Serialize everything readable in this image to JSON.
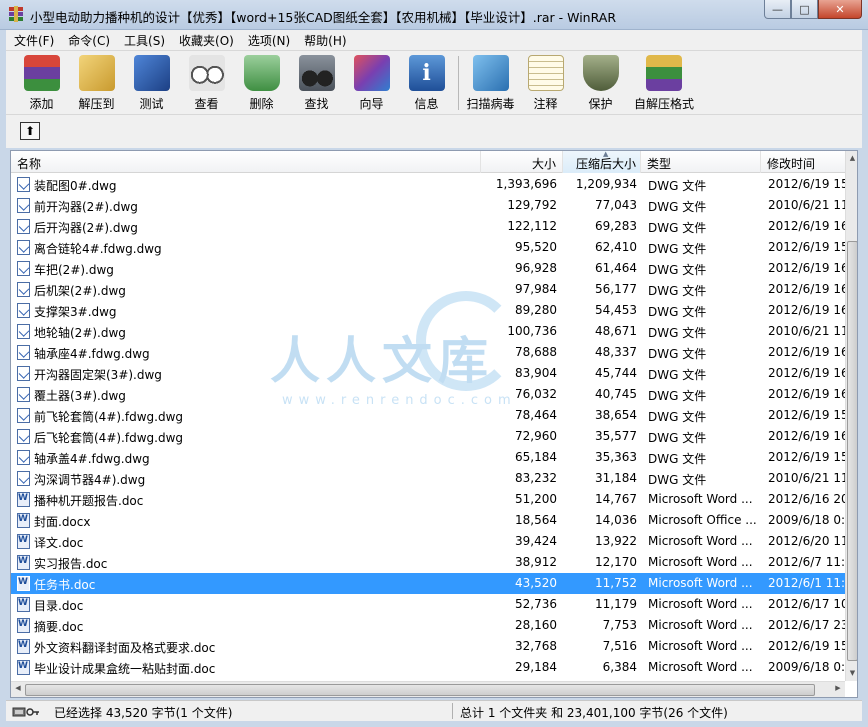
{
  "window": {
    "title": "小型电动助力播种机的设计【优秀】【word+15张CAD图纸全套】【农用机械】【毕业设计】.rar - WinRAR",
    "minimize_glyph": "—",
    "maximize_glyph": "□",
    "close_glyph": "✕"
  },
  "menu": [
    "文件(F)",
    "命令(C)",
    "工具(S)",
    "收藏夹(O)",
    "选项(N)",
    "帮助(H)"
  ],
  "toolbar": [
    {
      "label": "添加",
      "icon": "add-books-icon",
      "color": "#d8463b"
    },
    {
      "label": "解压到",
      "icon": "extract-folder-icon",
      "color": "#e3b640"
    },
    {
      "label": "测试",
      "icon": "test-book-icon",
      "color": "#2e5fb8"
    },
    {
      "label": "查看",
      "icon": "glasses-icon",
      "color": "#9a9a9a"
    },
    {
      "label": "删除",
      "icon": "recycle-bin-icon",
      "color": "#58a05a"
    },
    {
      "label": "查找",
      "icon": "binoculars-icon",
      "color": "#555c66"
    },
    {
      "label": "向导",
      "icon": "wizard-icon",
      "color": "#b2408e"
    },
    {
      "label": "信息",
      "icon": "info-icon",
      "color": "#2f6db5"
    },
    {
      "label": "扫描病毒",
      "icon": "scan-virus-icon",
      "color": "#3b8fd0"
    },
    {
      "label": "注释",
      "icon": "comment-icon",
      "color": "#e8d7a2"
    },
    {
      "label": "保护",
      "icon": "shield-icon",
      "color": "#6b7a55"
    },
    {
      "label": "自解压格式",
      "icon": "sfx-books-icon",
      "color": "#6a9b35"
    }
  ],
  "address": {
    "up_glyph": "⬆"
  },
  "columns": {
    "name": "名称",
    "size": "大小",
    "packed": "压缩后大小",
    "type": "类型",
    "modified": "修改时间",
    "sort_glyph": "▲"
  },
  "files": [
    {
      "name": "装配图0#.dwg",
      "size": "1,393,696",
      "packed": "1,209,934",
      "type": "DWG 文件",
      "modified": "2012/6/19 15",
      "kind": "dwg"
    },
    {
      "name": "前开沟器(2#).dwg",
      "size": "129,792",
      "packed": "77,043",
      "type": "DWG 文件",
      "modified": "2010/6/21 11",
      "kind": "dwg"
    },
    {
      "name": "后开沟器(2#).dwg",
      "size": "122,112",
      "packed": "69,283",
      "type": "DWG 文件",
      "modified": "2012/6/19 16",
      "kind": "dwg"
    },
    {
      "name": "离合链轮4#.fdwg.dwg",
      "size": "95,520",
      "packed": "62,410",
      "type": "DWG 文件",
      "modified": "2012/6/19 15",
      "kind": "dwg"
    },
    {
      "name": "车把(2#).dwg",
      "size": "96,928",
      "packed": "61,464",
      "type": "DWG 文件",
      "modified": "2012/6/19 16",
      "kind": "dwg"
    },
    {
      "name": "后机架(2#).dwg",
      "size": "97,984",
      "packed": "56,177",
      "type": "DWG 文件",
      "modified": "2012/6/19 16",
      "kind": "dwg"
    },
    {
      "name": "支撑架3#.dwg",
      "size": "89,280",
      "packed": "54,453",
      "type": "DWG 文件",
      "modified": "2012/6/19 16",
      "kind": "dwg"
    },
    {
      "name": "地轮轴(2#).dwg",
      "size": "100,736",
      "packed": "48,671",
      "type": "DWG 文件",
      "modified": "2010/6/21 11",
      "kind": "dwg"
    },
    {
      "name": "轴承座4#.fdwg.dwg",
      "size": "78,688",
      "packed": "48,337",
      "type": "DWG 文件",
      "modified": "2012/6/19 16",
      "kind": "dwg"
    },
    {
      "name": "开沟器固定架(3#).dwg",
      "size": "83,904",
      "packed": "45,744",
      "type": "DWG 文件",
      "modified": "2012/6/19 16",
      "kind": "dwg"
    },
    {
      "name": "覆土器(3#).dwg",
      "size": "76,032",
      "packed": "40,745",
      "type": "DWG 文件",
      "modified": "2012/6/19 16",
      "kind": "dwg"
    },
    {
      "name": "前飞轮套筒(4#).fdwg.dwg",
      "size": "78,464",
      "packed": "38,654",
      "type": "DWG 文件",
      "modified": "2012/6/19 15",
      "kind": "dwg"
    },
    {
      "name": "后飞轮套筒(4#).fdwg.dwg",
      "size": "72,960",
      "packed": "35,577",
      "type": "DWG 文件",
      "modified": "2012/6/19 16",
      "kind": "dwg"
    },
    {
      "name": "轴承盖4#.fdwg.dwg",
      "size": "65,184",
      "packed": "35,363",
      "type": "DWG 文件",
      "modified": "2012/6/19 15",
      "kind": "dwg"
    },
    {
      "name": "沟深调节器4#).dwg",
      "size": "83,232",
      "packed": "31,184",
      "type": "DWG 文件",
      "modified": "2010/6/21 11",
      "kind": "dwg"
    },
    {
      "name": "播种机开题报告.doc",
      "size": "51,200",
      "packed": "14,767",
      "type": "Microsoft Word ...",
      "modified": "2012/6/16 20",
      "kind": "doc"
    },
    {
      "name": "封面.docx",
      "size": "18,564",
      "packed": "14,036",
      "type": "Microsoft Office ...",
      "modified": "2009/6/18 0:",
      "kind": "doc"
    },
    {
      "name": "译文.doc",
      "size": "39,424",
      "packed": "13,922",
      "type": "Microsoft Word ...",
      "modified": "2012/6/20 11",
      "kind": "doc"
    },
    {
      "name": "实习报告.doc",
      "size": "38,912",
      "packed": "12,170",
      "type": "Microsoft Word ...",
      "modified": "2012/6/7 11:",
      "kind": "doc"
    },
    {
      "name": "任务书.doc",
      "size": "43,520",
      "packed": "11,752",
      "type": "Microsoft Word ...",
      "modified": "2012/6/1 11:",
      "kind": "doc",
      "selected": true
    },
    {
      "name": "目录.doc",
      "size": "52,736",
      "packed": "11,179",
      "type": "Microsoft Word ...",
      "modified": "2012/6/17 10",
      "kind": "doc"
    },
    {
      "name": "摘要.doc",
      "size": "28,160",
      "packed": "7,753",
      "type": "Microsoft Word ...",
      "modified": "2012/6/17 23",
      "kind": "doc"
    },
    {
      "name": "外文资料翻译封面及格式要求.doc",
      "size": "32,768",
      "packed": "7,516",
      "type": "Microsoft Word ...",
      "modified": "2012/6/19 15",
      "kind": "doc"
    },
    {
      "name": "毕业设计成果盒统一粘贴封面.doc",
      "size": "29,184",
      "packed": "6,384",
      "type": "Microsoft Word ...",
      "modified": "2009/6/18 0:",
      "kind": "doc"
    }
  ],
  "watermark": {
    "text": "人人文库",
    "url": "www.renrendoc.com"
  },
  "status": {
    "left": "已经选择 43,520 字节(1 个文件)",
    "right": "总计 1 个文件夹 和 23,401,100 字节(26 个文件)"
  }
}
